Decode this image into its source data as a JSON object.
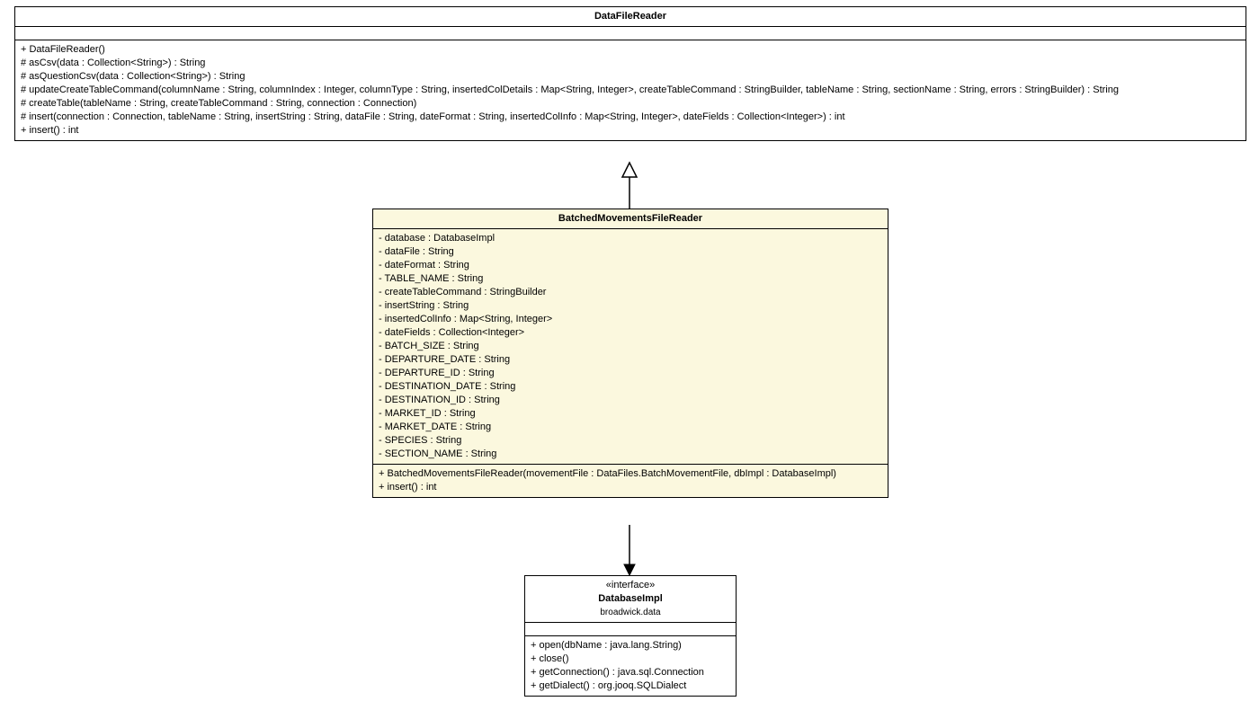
{
  "dataFileReader": {
    "title": "DataFileReader",
    "methods": [
      "+ DataFileReader()",
      "# asCsv(data : Collection<String>) : String",
      "# asQuestionCsv(data : Collection<String>) : String",
      "# updateCreateTableCommand(columnName : String, columnIndex : Integer, columnType : String, insertedColDetails : Map<String, Integer>, createTableCommand : StringBuilder, tableName : String, sectionName : String, errors : StringBuilder) : String",
      "# createTable(tableName : String, createTableCommand : String, connection : Connection)",
      "# insert(connection : Connection, tableName : String, insertString : String, dataFile : String, dateFormat : String, insertedColInfo : Map<String, Integer>, dateFields : Collection<Integer>) : int",
      "+ insert() : int"
    ]
  },
  "batchedReader": {
    "title": "BatchedMovementsFileReader",
    "attributes": [
      "- database : DatabaseImpl",
      "- dataFile : String",
      "- dateFormat : String",
      "- TABLE_NAME : String",
      "- createTableCommand : StringBuilder",
      "- insertString : String",
      "- insertedColInfo : Map<String, Integer>",
      "- dateFields : Collection<Integer>",
      "- BATCH_SIZE : String",
      "- DEPARTURE_DATE : String",
      "- DEPARTURE_ID : String",
      "- DESTINATION_DATE : String",
      "- DESTINATION_ID : String",
      "- MARKET_ID : String",
      "- MARKET_DATE : String",
      "- SPECIES : String",
      "- SECTION_NAME : String"
    ],
    "methods": [
      "+ BatchedMovementsFileReader(movementFile : DataFiles.BatchMovementFile, dbImpl : DatabaseImpl)",
      "+ insert() : int"
    ]
  },
  "databaseImpl": {
    "stereotype": "«interface»",
    "title": "DatabaseImpl",
    "package": "broadwick.data",
    "methods": [
      "+ open(dbName : java.lang.String)",
      "+ close()",
      "+ getConnection() : java.sql.Connection",
      "+ getDialect() : org.jooq.SQLDialect"
    ]
  }
}
